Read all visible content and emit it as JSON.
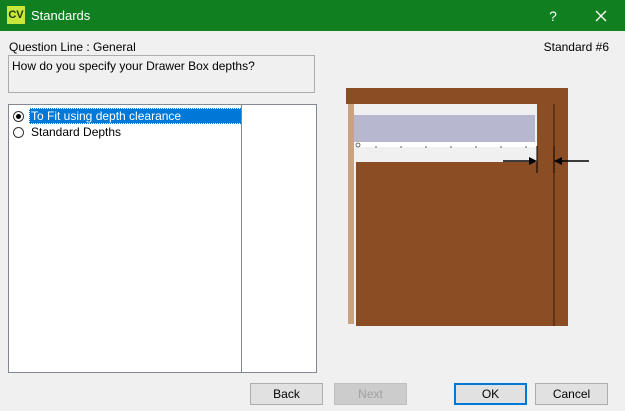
{
  "window": {
    "app_icon_text": "CV",
    "title": "Standards",
    "help_label": "?"
  },
  "question": {
    "line_label": "Question Line : General",
    "standard_number": "Standard #6",
    "text": "How do you specify your Drawer Box depths?"
  },
  "options": [
    {
      "label": "To Fit using depth clearance",
      "checked": true
    },
    {
      "label": "Standard Depths",
      "checked": false
    }
  ],
  "preview": {
    "cabinet_color": "#8b4e24",
    "drawer_color": "#b7b7cf"
  },
  "buttons": {
    "back": "Back",
    "next": "Next",
    "ok": "OK",
    "cancel": "Cancel"
  }
}
